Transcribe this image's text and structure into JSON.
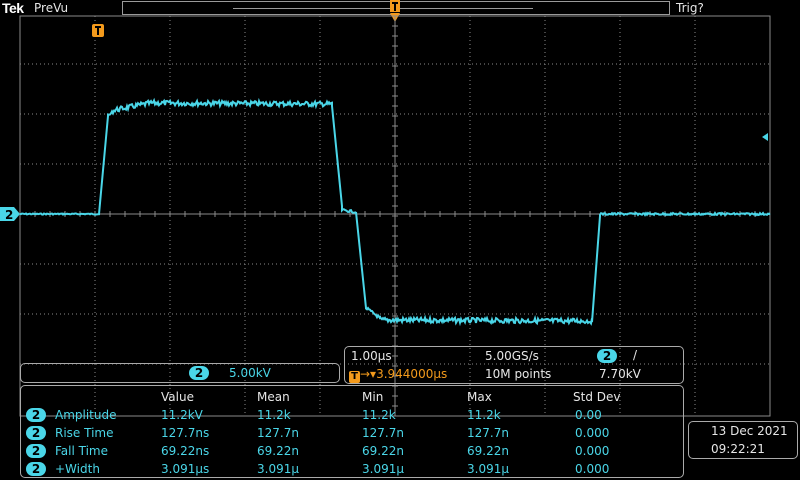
{
  "top_bar": {
    "brand": "Tek",
    "mode": "PreVu",
    "trigger_status": "Trig?"
  },
  "trigger_marker_label": "T",
  "channel": {
    "number": "2",
    "color": "#4ad6e8",
    "scale": "5.00kV"
  },
  "horizontal": {
    "time_per_div": "1.00µs",
    "sample_rate": "5.00GS/s",
    "trigger_icon": "T",
    "trigger_delay": "3.944000µs",
    "record_length": "10M points",
    "trigger_channel": "2",
    "trigger_slope": "/",
    "trigger_level": "7.70kV"
  },
  "measurements": {
    "columns": [
      "Value",
      "Mean",
      "Min",
      "Max",
      "Std Dev"
    ],
    "rows": [
      {
        "ch": "2",
        "label": "Amplitude",
        "value": "11.2kV",
        "mean": "11.2k",
        "min": "11.2k",
        "max": "11.2k",
        "std": "0.00"
      },
      {
        "ch": "2",
        "label": "Rise Time",
        "value": "127.7ns",
        "mean": "127.7n",
        "min": "127.7n",
        "max": "127.7n",
        "std": "0.000"
      },
      {
        "ch": "2",
        "label": "Fall Time",
        "value": "69.22ns",
        "mean": "69.22n",
        "min": "69.22n",
        "max": "69.22n",
        "std": "0.000"
      },
      {
        "ch": "2",
        "label": "+Width",
        "value": "3.091µs",
        "mean": "3.091µ",
        "min": "3.091µ",
        "max": "3.091µ",
        "std": "0.000"
      }
    ]
  },
  "datetime": {
    "date": "13 Dec  2021",
    "time": "09:22:21"
  },
  "colors": {
    "trace": "#4ad6e8",
    "trigger": "#f39a1c",
    "grid": "#8a8a8a"
  }
}
